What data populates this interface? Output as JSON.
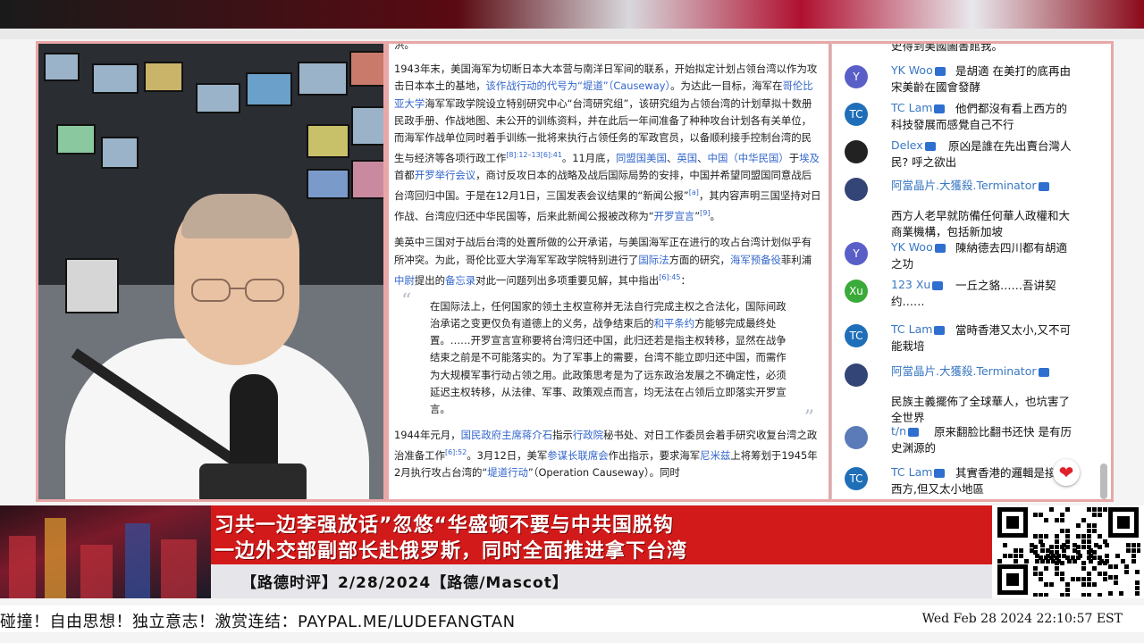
{
  "article": {
    "fragment_top": "洪。",
    "p1": [
      {
        "t": "1943年末，美国海军为切断日本大本营与南洋日军间的联系，开始拟定计划占领台湾以作为攻击日本本土的基地，"
      },
      {
        "t": "该作战行动的代号为“堤道”（Causeway）",
        "link": true
      },
      {
        "t": "。为达此一目标，海军在"
      },
      {
        "t": "哥伦比亚大学",
        "link": true
      },
      {
        "t": "海军军政学院设立特别研究中心“台湾研究组”，该研究组为占领台湾的计划草拟十数册民政手册、作战地图、未公开的训练资料，并在此后一年间准备了种种攻台计划各有关单位，而海军作战单位同时着手训练一批将来执行占领任务的军政官员，以备顺利接手控制台湾的民生与经济等各项行政工作"
      },
      {
        "t": "[8]:12–13[6]:41",
        "sup": true
      },
      {
        "t": "。11月底，"
      },
      {
        "t": "同盟国美国",
        "link": true
      },
      {
        "t": "、"
      },
      {
        "t": "英国",
        "link": true
      },
      {
        "t": "、"
      },
      {
        "t": "中国（中华民国）",
        "link": true
      },
      {
        "t": "于"
      },
      {
        "t": "埃及",
        "link": true
      },
      {
        "t": "首都"
      },
      {
        "t": "开罗举行会议",
        "link": true
      },
      {
        "t": "，商讨反攻日本的战略及战后国际局势的安排，中国并希望同盟国同意战后台湾回归中国。于是在12月1日，三国发表会议结果的“新闻公报”"
      },
      {
        "t": "[a]",
        "sup": true
      },
      {
        "t": "，其内容声明三国坚持对日作战、台湾应归还中华民国等，后来此新闻公报被改称为“"
      },
      {
        "t": "开罗宣言",
        "link": true
      },
      {
        "t": "”"
      },
      {
        "t": "[9]",
        "sup": true
      },
      {
        "t": "。"
      }
    ],
    "p2": [
      {
        "t": "美英中三国对于战后台湾的处置所做的公开承诺，与美国海军正在进行的攻占台湾计划似乎有所冲突。为此，哥伦比亚大学海军军政学院特别进行了"
      },
      {
        "t": "国际法",
        "link": true
      },
      {
        "t": "方面的研究，"
      },
      {
        "t": "海军预备役",
        "link": true
      },
      {
        "t": "菲利浦"
      },
      {
        "t": "中尉",
        "link": true
      },
      {
        "t": "提出的"
      },
      {
        "t": "备忘录",
        "link": true
      },
      {
        "t": "对此一问题列出多项重要见解，其中指出"
      },
      {
        "t": "[6]:45",
        "sup": true
      },
      {
        "t": "："
      }
    ],
    "quote": [
      {
        "t": "在国际法上，任何国家的领土主权宣称并无法自行完成主权之合法化，国际间政治承诺之变更仅负有道德上的义务，战争结束后的"
      },
      {
        "t": "和平条约",
        "link": true
      },
      {
        "t": "方能够完成最终处置。……开罗宣言宣称要将台湾归还中国，此归还若是指主权转移，显然在战争结束之前是不可能落实的。为了军事上的需要，台湾不能立即归还中国，而需作为大规模军事行动占领之用。此政策思考是为了远东政治发展之不确定性，必须延迟主权转移，从法律、军事、政策观点而言，均无法在占领后立即落实开罗宣言。"
      }
    ],
    "p3": [
      {
        "t": "1944年元月，"
      },
      {
        "t": "国民政府主席蒋介石",
        "link": true
      },
      {
        "t": "指示"
      },
      {
        "t": "行政院",
        "link": true
      },
      {
        "t": "秘书处、对日工作委员会着手研究收复台湾之政治准备工作"
      },
      {
        "t": "[6]:52",
        "sup": true
      },
      {
        "t": "。3月12日，美军"
      },
      {
        "t": "参谋长联席会",
        "link": true
      },
      {
        "t": "作出指示，要求海军"
      },
      {
        "t": "尼米兹",
        "link": true
      },
      {
        "t": "上将筹划于1945年2月执行攻占台湾的“"
      },
      {
        "t": "堤道行动",
        "link": true
      },
      {
        "t": "”（Operation Causeway）。同时"
      }
    ]
  },
  "chat": {
    "top_fragment": "史得到美國圖書館我。",
    "messages": [
      {
        "avatar": "Y",
        "color": "#5a5fc8",
        "name": "YK Woo",
        "text": "是胡適 在美打的底再由宋美齡在國會發酵"
      },
      {
        "avatar": "TC",
        "color": "#1f6fb8",
        "name": "TC Lam",
        "text": "他們都沒有看上西方的科技發展而感覺自己不行"
      },
      {
        "avatar": "",
        "color": "#222",
        "name": "Delex",
        "text": "原凶是誰在先出賣台灣人民? 呼之欲出"
      },
      {
        "avatar": "",
        "color": "#334477",
        "name": "阿當晶片.大獲殺.Terminator",
        "text": "西方人老早就防備任何華人政權和大商業機構，包括新加坡"
      },
      {
        "avatar": "Y",
        "color": "#5a5fc8",
        "name": "YK Woo",
        "text": "陳納德去四川都有胡適之功"
      },
      {
        "avatar": "Xu",
        "color": "#3aaa3a",
        "name": "123 Xu",
        "text": "一丘之貉……吾讲契约……"
      },
      {
        "avatar": "TC",
        "color": "#1f6fb8",
        "name": "TC Lam",
        "text": "當時香港又太小,又不可能栽培"
      },
      {
        "avatar": "",
        "color": "#334477",
        "name": "阿當晶片.大獲殺.Terminator",
        "text": "民族主義擺佈了全球華人，也坑害了全世界"
      },
      {
        "avatar": "",
        "color": "#5a7ab8",
        "name": "t/n",
        "text": "原来翻脸比翻书还快 是有历史渊源的"
      },
      {
        "avatar": "TC",
        "color": "#1f6fb8",
        "name": "TC Lam",
        "text": "其實香港的邏輯是接近西方,但又太小地區"
      }
    ]
  },
  "banner": {
    "title_line1": "习共一边李强放话”忽悠“华盛顿不要与中共国脱钩",
    "title_line2": "一边外交部副部长赴俄罗斯，同时全面推进拿下台湾",
    "subtitle": "【路德时评】2/28/2024【路德/Mascot】"
  },
  "ticker": {
    "text": "碰撞！自由思想！独立意志！激赏连结：PAYPAL.ME/LUDEFANGTAN",
    "clock": "Wed Feb 28 2024 22:10:57 EST"
  },
  "colors": {
    "accent_red": "#d31a1a",
    "link_blue": "#3366cc",
    "frame_pink": "#e8a7a7"
  }
}
